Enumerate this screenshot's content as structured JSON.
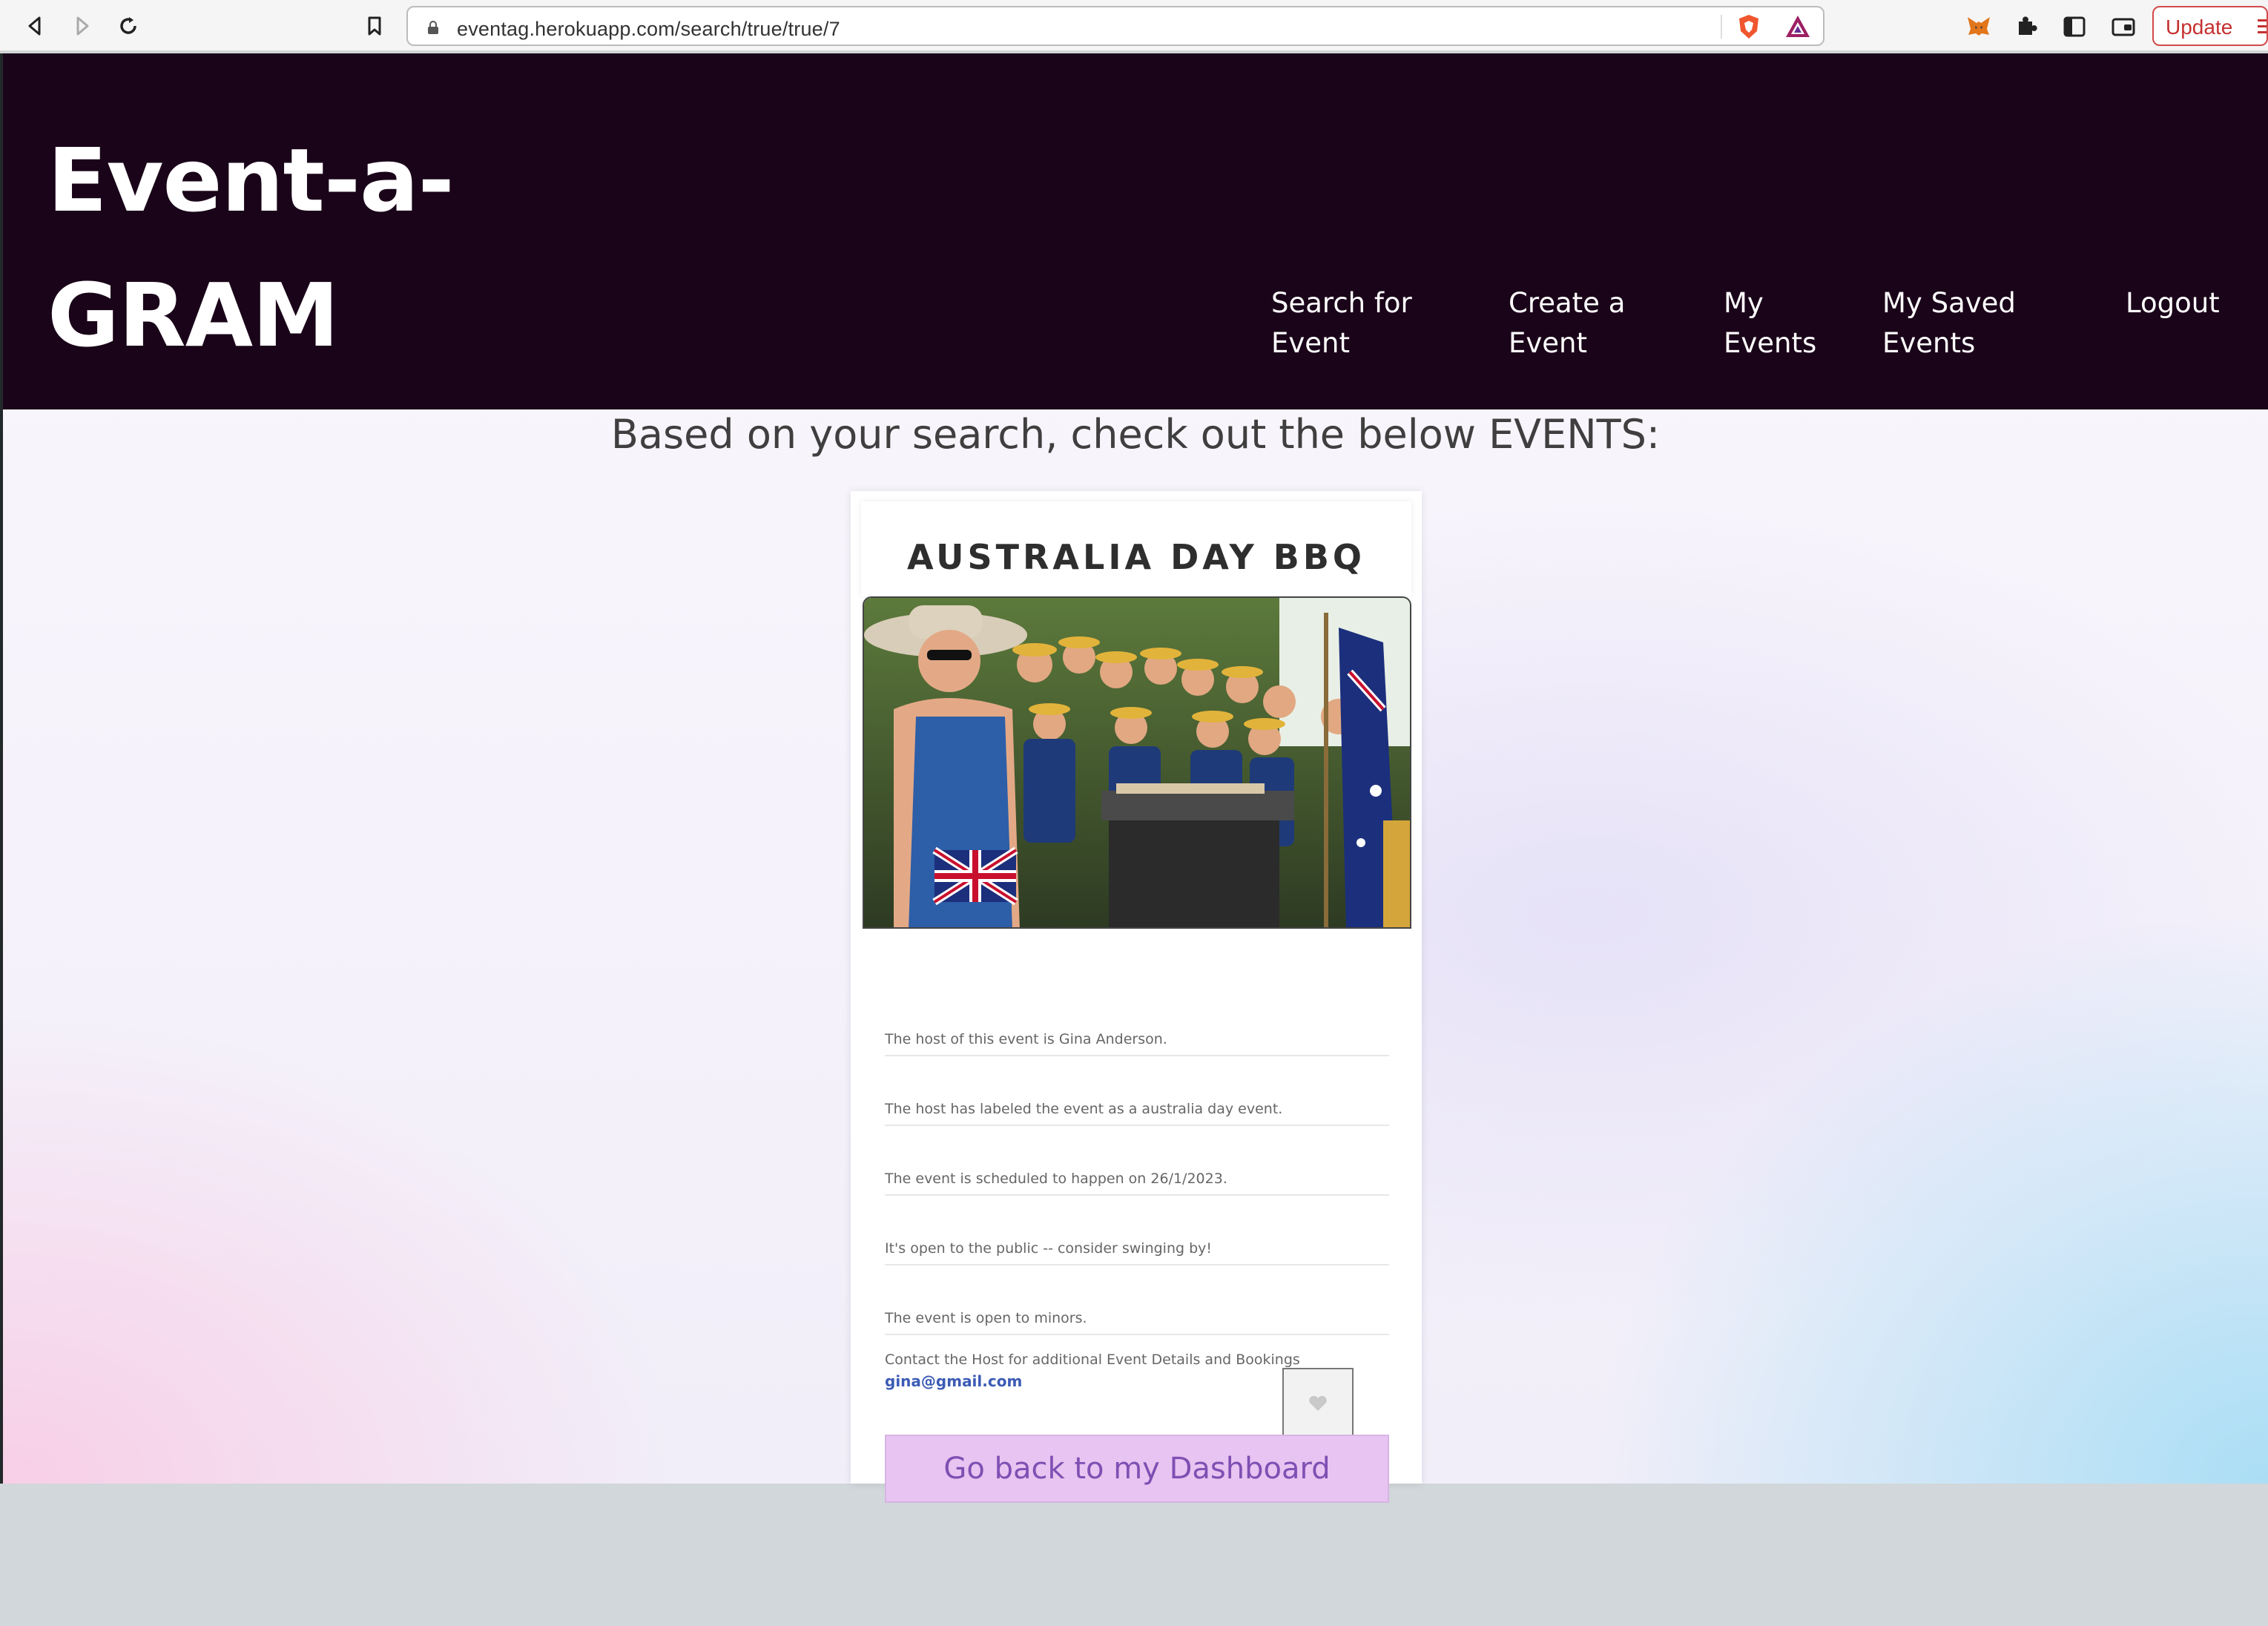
{
  "browser": {
    "url": "eventag.herokuapp.com/search/true/true/7",
    "update_label": "Update"
  },
  "site": {
    "logo_line1": "Event-a-",
    "logo_line2": "GRAM",
    "nav": [
      {
        "line1": "Search for",
        "line2": "Event"
      },
      {
        "line1": "Create a",
        "line2": "Event"
      },
      {
        "line1": "My",
        "line2": "Events"
      },
      {
        "line1": "My Saved",
        "line2": "Events"
      },
      {
        "line1": "Logout",
        "line2": ""
      }
    ]
  },
  "results": {
    "headline": "Based on your search, check out the below EVENTS:"
  },
  "event": {
    "title": "AUSTRALIA DAY BBQ",
    "host_line": "The host of this event is Gina Anderson.",
    "label_line": "The host has labeled the event as a australia day event.",
    "date_line": "The event is scheduled to happen on 26/1/2023.",
    "public_line": "It's open to the public -- consider swinging by!",
    "minors_line": "The event is open to minors.",
    "contact_line": "Contact the Host for additional Event Details and Bookings",
    "contact_email": "gina@gmail.com",
    "dashboard_button": "Go back to my Dashboard"
  },
  "colors": {
    "header_bg": "#1a0419",
    "button_bg": "#e7c4f1",
    "button_text": "#7f4fb3",
    "email_link": "#3b5bb5"
  },
  "icons": [
    "back-icon",
    "forward-icon",
    "reload-icon",
    "bookmark-icon",
    "lock-icon",
    "brave-shield-icon",
    "brave-rewards-icon",
    "metamask-icon",
    "extensions-icon",
    "sidebar-icon",
    "wallet-icon",
    "heart-icon"
  ]
}
